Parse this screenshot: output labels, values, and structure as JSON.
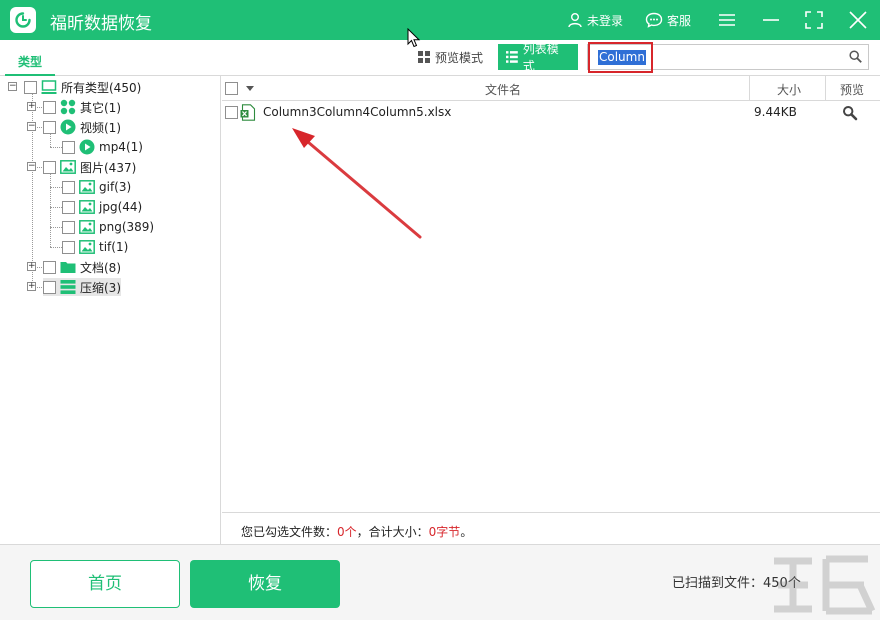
{
  "app": {
    "title": "福昕数据恢复",
    "accent": "#1fbf76",
    "highlight": "#d7262b"
  },
  "titlebar": {
    "login_label": "未登录",
    "service_label": "客服"
  },
  "toolbar": {
    "tab_type": "类型",
    "mode_preview": "预览模式",
    "mode_list": "列表模式",
    "search_value": "Column"
  },
  "tree": {
    "root": {
      "label": "所有类型(450)",
      "icon": "computer-icon"
    },
    "other": {
      "label": "其它(1)",
      "icon": "other-grid-icon"
    },
    "video": {
      "label": "视频(1)",
      "icon": "video-play-icon"
    },
    "mp4": {
      "label": "mp4(1)",
      "icon": "video-play-icon"
    },
    "image": {
      "label": "图片(437)",
      "icon": "image-icon"
    },
    "gif": {
      "label": "gif(3)",
      "icon": "image-icon"
    },
    "jpg": {
      "label": "jpg(44)",
      "icon": "image-icon"
    },
    "png": {
      "label": "png(389)",
      "icon": "image-icon"
    },
    "tif": {
      "label": "tif(1)",
      "icon": "image-icon"
    },
    "doc": {
      "label": "文档(8)",
      "icon": "folder-icon"
    },
    "zip": {
      "label": "压缩(3)",
      "icon": "archive-icon"
    }
  },
  "list": {
    "columns": {
      "name": "文件名",
      "size": "大小",
      "preview": "预览"
    },
    "rows": [
      {
        "name": "Column3Column4Column5.xlsx",
        "size": "9.44KB",
        "icon": "excel-file-icon"
      }
    ]
  },
  "status": {
    "prefix": "您已勾选文件数：",
    "count": "0个",
    "mid": "，合计大小：",
    "size": "0字节",
    "suffix": "。"
  },
  "bottom": {
    "home_label": "首页",
    "recover_label": "恢复",
    "scan_label": "已扫描到文件：",
    "scan_count": "450个"
  }
}
